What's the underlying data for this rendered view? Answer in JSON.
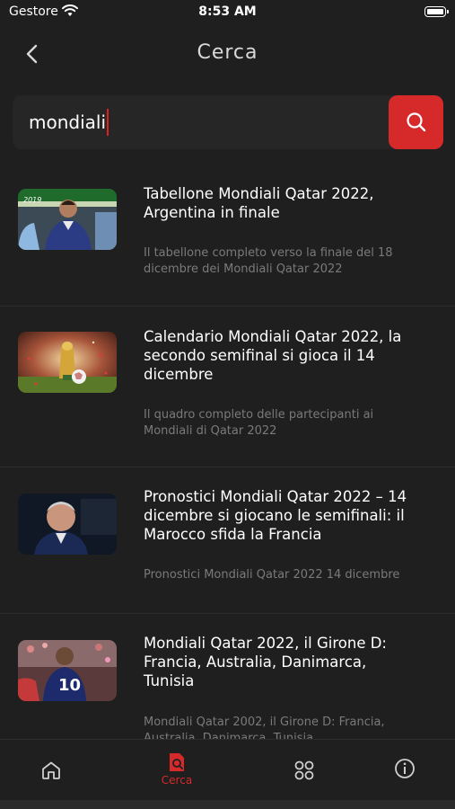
{
  "status_bar": {
    "carrier": "Gestore",
    "time": "8:53 AM"
  },
  "header": {
    "title": "Cerca"
  },
  "search": {
    "value": "mondiali"
  },
  "results": [
    {
      "title_lines": [
        "Tabellone Mondiali Qatar 2022,",
        "Argentina in finale"
      ],
      "desc_lines": [
        "Il tabellone completo verso la finale del 18",
        "dicembre dei Mondiali Qatar 2022"
      ],
      "thumb_text": "2019"
    },
    {
      "title_lines": [
        "Calendario Mondiali Qatar 2022, la",
        "secondo semifinal si gioca il 14",
        "dicembre"
      ],
      "desc_lines": [
        "Il quadro completo delle partecipanti ai",
        "Mondiali di Qatar 2022"
      ]
    },
    {
      "title_lines": [
        "Pronostici Mondiali Qatar 2022 – 14",
        "dicembre si giocano le semifinali: il",
        "Marocco sfida la Francia"
      ],
      "desc_lines": [
        "Pronostici Mondiali Qatar 2022 14 dicembre"
      ]
    },
    {
      "title_lines": [
        "Mondiali Qatar 2022, il Girone D:",
        "Francia, Australia, Danimarca,",
        "Tunisia"
      ],
      "desc_lines": [
        "Mondiali Qatar 2002, il Girone D: Francia,",
        "Australia, Danimarca, Tunisia"
      ],
      "thumb_text": "10"
    }
  ],
  "tabbar": {
    "search_label": "Cerca"
  },
  "colors": {
    "accent": "#d62a2a",
    "background": "#1f1f1f",
    "muted_text": "#7a7a7a"
  },
  "icons": [
    "back-chevron-icon",
    "search-icon",
    "home-icon",
    "search-document-icon",
    "grid-icon",
    "info-icon"
  ]
}
